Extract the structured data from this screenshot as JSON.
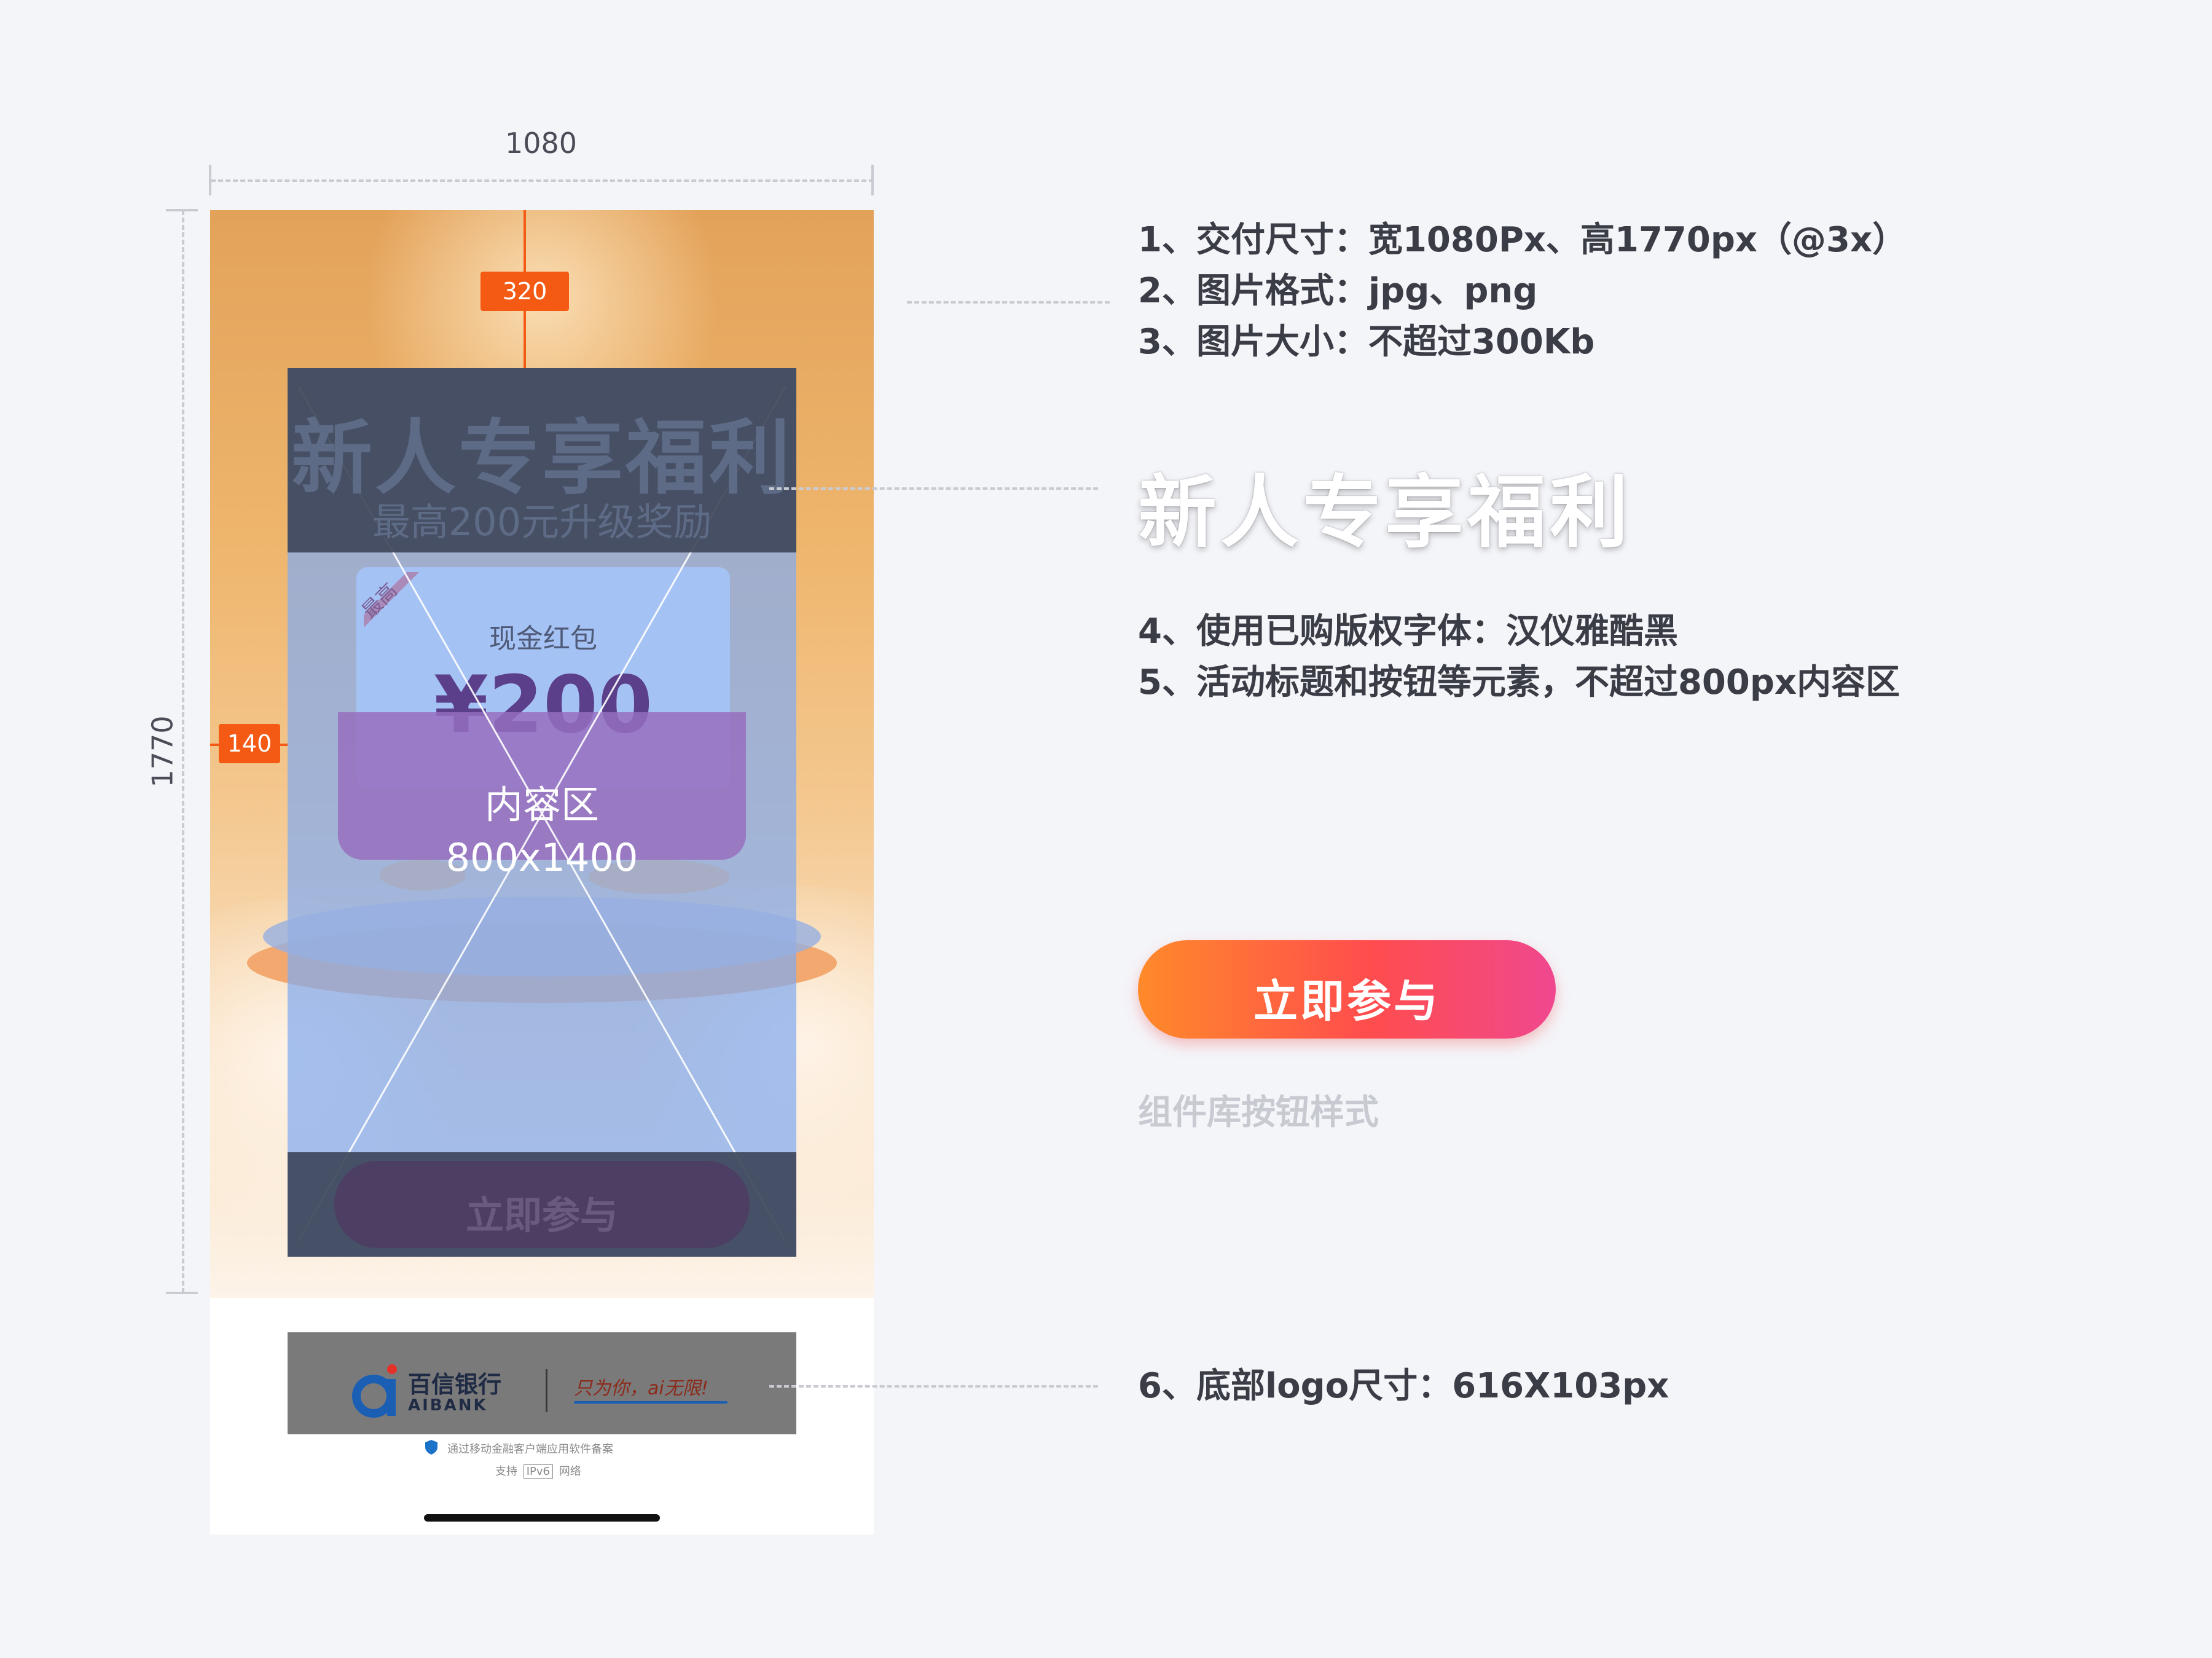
{
  "dimensions": {
    "width_label": "1080",
    "height_label": "1770"
  },
  "artwork": {
    "title": "新人专享福利",
    "subtitle": "最高200元升级奖励",
    "coupon_label": "现金红包",
    "coupon_amount": "¥200",
    "corner_badge": "最高",
    "content_area_label": "内容区",
    "content_area_size": "800x1400",
    "ghost_button": "立即参与",
    "margin_top_tag": "320",
    "margin_side_tag": "140"
  },
  "footer": {
    "bank_name": "百信银行",
    "bank_name_en": "AIBANK",
    "slogan": "只为你，ai无限!",
    "record_note": "通过移动金融客户端应用软件备案",
    "ipv6_note_prefix": "支持",
    "ipv6_badge": "IPv6",
    "ipv6_note_suffix": "网络"
  },
  "specs": {
    "item1": "1、交付尺寸：宽1080Px、高1770px（@3x）",
    "item2": "2、图片格式：jpg、png",
    "item3": "3、图片大小：不超过300Kb",
    "title_sample": "新人专享福利",
    "item4": "4、使用已购版权字体：汉仪雅酷黑",
    "item5": "5、活动标题和按钮等元素，不超过800px内容区",
    "button_label": "立即参与",
    "button_caption": "组件库按钮样式",
    "item6": "6、底部logo尺寸：616X103px"
  },
  "colors": {
    "marker": "#f45a14",
    "cta_start": "#ff8a2a",
    "cta_end": "#f0488f"
  }
}
